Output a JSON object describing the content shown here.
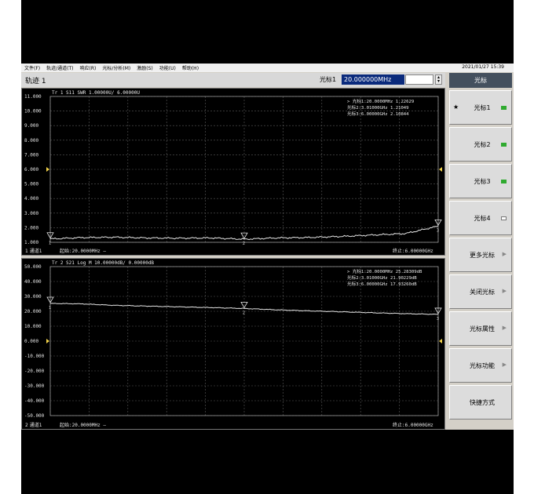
{
  "menu": {
    "items": [
      "文件(F)",
      "轨迹/通道(T)",
      "响应(R)",
      "光标/分析(M)",
      "激励(S)",
      "功能(U)",
      "帮助(H)"
    ],
    "datetime": "2021/01/27 15:39"
  },
  "header": {
    "trace_title": "轨迹 1",
    "marker_label": "光标1",
    "marker_value": "20.000000MHz"
  },
  "sidebar": {
    "title": "光标",
    "buttons": [
      {
        "label": "光标1",
        "star": "★",
        "indicator": "on"
      },
      {
        "label": "光标2",
        "indicator": "on"
      },
      {
        "label": "光标3",
        "indicator": "on"
      },
      {
        "label": "光标4",
        "indicator": "off"
      },
      {
        "label": "更多光标",
        "arrow": "▶"
      },
      {
        "label": "关闭光标",
        "arrow": "▶"
      },
      {
        "label": "光标属性",
        "arrow": "▶"
      },
      {
        "label": "光标功能",
        "arrow": "▶"
      },
      {
        "label": "快捷方式"
      }
    ]
  },
  "chart_data": [
    {
      "type": "line",
      "title": "Tr 1  S11 SWR 1.00000U/ 6.00000U",
      "trace_tag": "Tr 1",
      "yticks": [
        "11.000",
        "10.000",
        "9.000",
        "8.000",
        "7.000",
        "6.000",
        "5.000",
        "4.000",
        "3.000",
        "2.000",
        "1.000"
      ],
      "ylim": [
        1,
        11
      ],
      "xlim": [
        0.02,
        6.0
      ],
      "x": [
        0.02,
        0.5,
        1.0,
        1.5,
        2.0,
        2.5,
        3.01,
        3.5,
        4.0,
        4.5,
        5.0,
        5.5,
        6.0
      ],
      "series": [
        {
          "values": [
            1.23,
            1.32,
            1.35,
            1.3,
            1.28,
            1.3,
            1.21,
            1.3,
            1.33,
            1.4,
            1.5,
            1.6,
            2.11
          ]
        }
      ],
      "markers": [
        {
          "label": "光标1:20.0000MHz 1.22629"
        },
        {
          "label": "光标2:3.01000GHz 1.21049"
        },
        {
          "label": "光标3:6.00000GHz 2.10844"
        }
      ],
      "marker_numbers": [
        "1",
        "2",
        "3"
      ],
      "channel": "1 通道1",
      "start": "起始:20.0000MHz —",
      "stop": "终止:6.00000GHz",
      "grid": true
    },
    {
      "type": "line",
      "title": "Tr 2  S21 Log M 10.00000dB/ 0.00000dB",
      "yticks": [
        "50.000",
        "40.000",
        "30.000",
        "20.000",
        "10.000",
        "0.000",
        "-10.000",
        "-20.000",
        "-30.000",
        "-40.000",
        "-50.000"
      ],
      "ylim": [
        -50,
        50
      ],
      "xlim": [
        0.02,
        6.0
      ],
      "x": [
        0.02,
        0.5,
        1.0,
        1.5,
        2.0,
        2.5,
        3.01,
        3.5,
        4.0,
        4.5,
        5.0,
        5.5,
        6.0
      ],
      "series": [
        {
          "values": [
            25.28,
            25.0,
            24.0,
            23.5,
            23.0,
            22.5,
            21.9,
            21.0,
            20.3,
            19.7,
            19.0,
            18.4,
            17.93
          ]
        }
      ],
      "markers": [
        {
          "label": "光标1:20.0000MHz 25.28309dB"
        },
        {
          "label": "光标2:3.01000GHz 21.90229dB"
        },
        {
          "label": "光标3:6.00000GHz 17.93260dB"
        }
      ],
      "marker_numbers": [
        "1",
        "2",
        "3"
      ],
      "channel": "2 通道1",
      "start": "起始:20.0000MHz —",
      "stop": "终止:6.00000GHz",
      "grid": true
    }
  ]
}
